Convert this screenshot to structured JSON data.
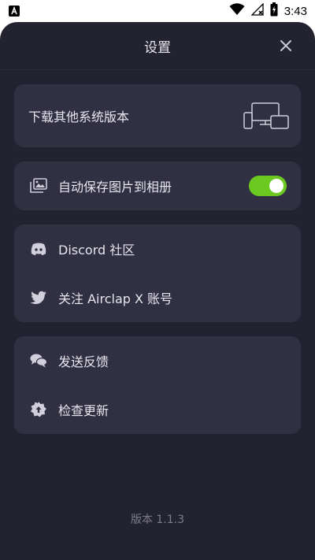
{
  "status_bar": {
    "time": "3:43",
    "icons": [
      "app-notification-icon",
      "wifi-icon",
      "no-signal-icon",
      "battery-charging-icon"
    ]
  },
  "header": {
    "title": "设置",
    "close_icon": "close-icon"
  },
  "download_card": {
    "label": "下载其他系统版本",
    "icon": "devices-icon"
  },
  "save_card": {
    "label": "自动保存图片到相册",
    "icon": "gallery-icon",
    "toggle_on": true,
    "toggle_color": "#6cc91f"
  },
  "community_card": {
    "items": [
      {
        "label": "Discord 社区",
        "icon": "discord-icon"
      },
      {
        "label": "关注 Airclap X 账号",
        "icon": "twitter-icon"
      }
    ]
  },
  "support_card": {
    "items": [
      {
        "label": "发送反馈",
        "icon": "chat-icon"
      },
      {
        "label": "检查更新",
        "icon": "update-icon"
      }
    ]
  },
  "footer": {
    "version": "版本 1.1.3"
  },
  "colors": {
    "background": "#232231",
    "card": "#312f42",
    "accent": "#6cc91f"
  }
}
